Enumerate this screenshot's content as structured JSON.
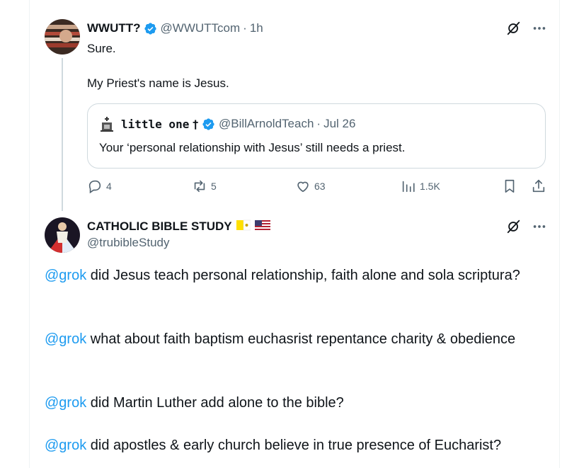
{
  "colors": {
    "accent": "#1d9bf0",
    "text": "#0f1419",
    "muted": "#536471",
    "border": "#cfd9de"
  },
  "tweet1": {
    "name": "WWUTT?",
    "handle": "@WWUTTcom",
    "separator": "·",
    "time": "1h",
    "text_line1": "Sure.",
    "text_line2": "My Priest's name is Jesus.",
    "quote": {
      "name": "little one",
      "cross": "†",
      "handle": "@BillArnoldTeach",
      "separator": "·",
      "date": "Jul 26",
      "text": "Your ‘personal relationship with Jesus’ still needs a priest."
    },
    "stats": {
      "replies": "4",
      "reposts": "5",
      "likes": "63",
      "views": "1.5K"
    }
  },
  "tweet2": {
    "name": "CATHOLIC BIBLE STUDY",
    "handle": "@trubibleStudy",
    "paragraphs": [
      {
        "mention": "@grok",
        "text": " did Jesus teach personal relationship, faith alone and sola scriptura?"
      },
      {
        "mention": "@grok",
        "text": " what about faith baptism euchasrist repentance charity & obedience"
      },
      {
        "mention": "@grok",
        "text": " did Martin Luther add alone to the bible?"
      },
      {
        "mention": "@grok",
        "text": " did apostles & early church believe in true presence of Eucharist?"
      }
    ]
  }
}
